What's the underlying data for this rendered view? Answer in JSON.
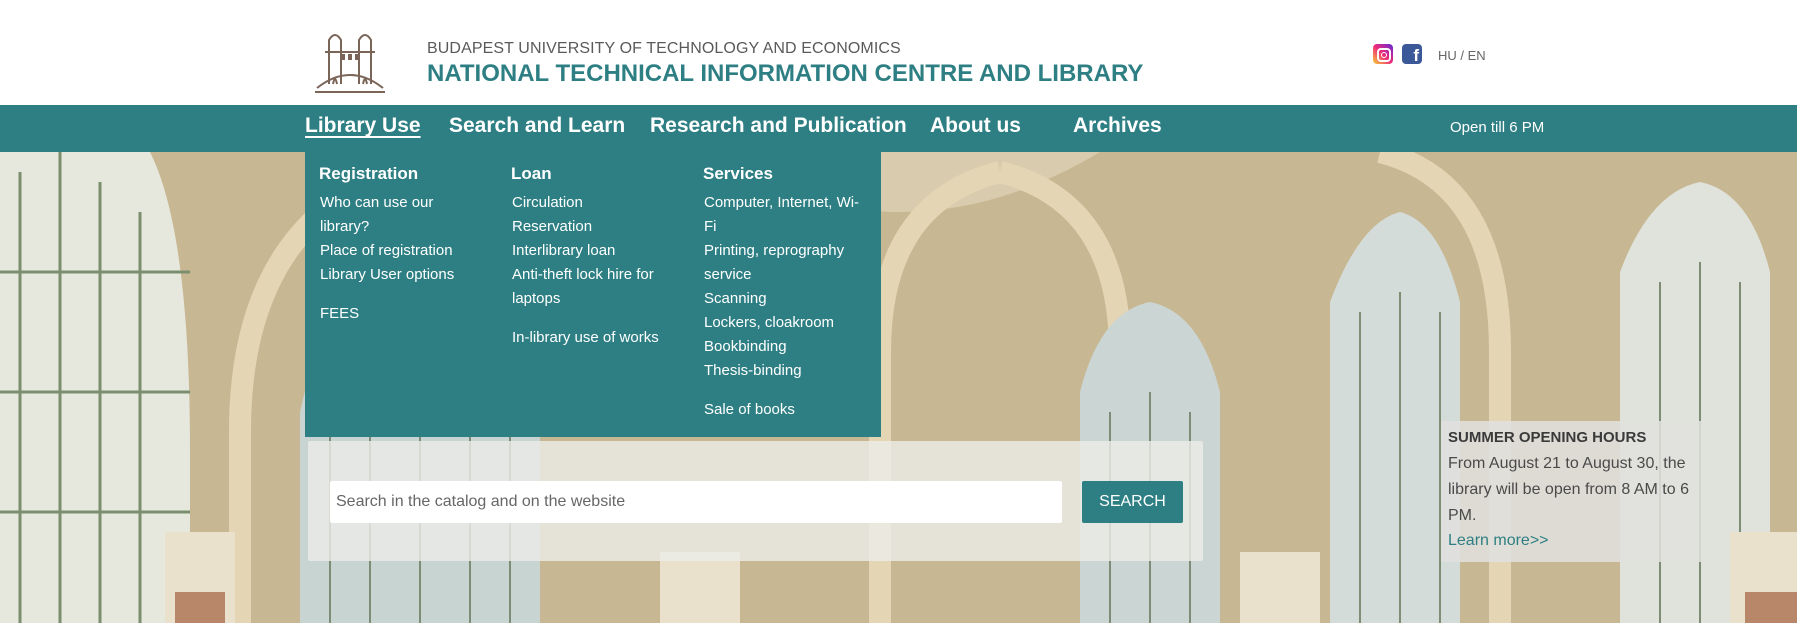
{
  "header": {
    "university": "BUDAPEST UNIVERSITY OF TECHNOLOGY AND ECONOMICS",
    "library": "NATIONAL TECHNICAL INFORMATION CENTRE AND LIBRARY",
    "logo_icon": "bridge-towers-logo-icon",
    "social_icons": [
      "instagram-icon",
      "facebook-icon"
    ],
    "language": "HU / EN"
  },
  "nav": {
    "items": [
      "Library Use",
      "Search and Learn",
      "Research and Publication",
      "About us",
      "Archives"
    ],
    "active": "Library Use",
    "open_status": "Open till 6 PM"
  },
  "dropdown": {
    "columns": [
      {
        "title": "Registration",
        "links": [
          "Who can use our library?",
          "Place of registration",
          "Library User options"
        ],
        "extra": "FEES"
      },
      {
        "title": "Loan",
        "links": [
          "Circulation",
          "Reservation",
          "Interlibrary loan",
          "Anti-theft lock hire for laptops"
        ],
        "extra": "In-library use of works"
      },
      {
        "title": "Services",
        "links": [
          "Computer, Internet, Wi-Fi",
          "Printing, reprography service",
          "Scanning",
          "Lockers, cloakroom",
          "Bookbinding",
          "Thesis-binding"
        ],
        "extra": "Sale of books"
      }
    ]
  },
  "search": {
    "placeholder": "Search in the catalog and on the website",
    "button": "SEARCH"
  },
  "notice": {
    "title": "SUMMER OPENING HOURS",
    "body": "From August 21 to August 30, the library will be open from 8 AM to 6 PM.",
    "link": "Learn more>>"
  },
  "colors": {
    "accent": "#2e7f83",
    "text_dark": "#5a5a5a"
  }
}
